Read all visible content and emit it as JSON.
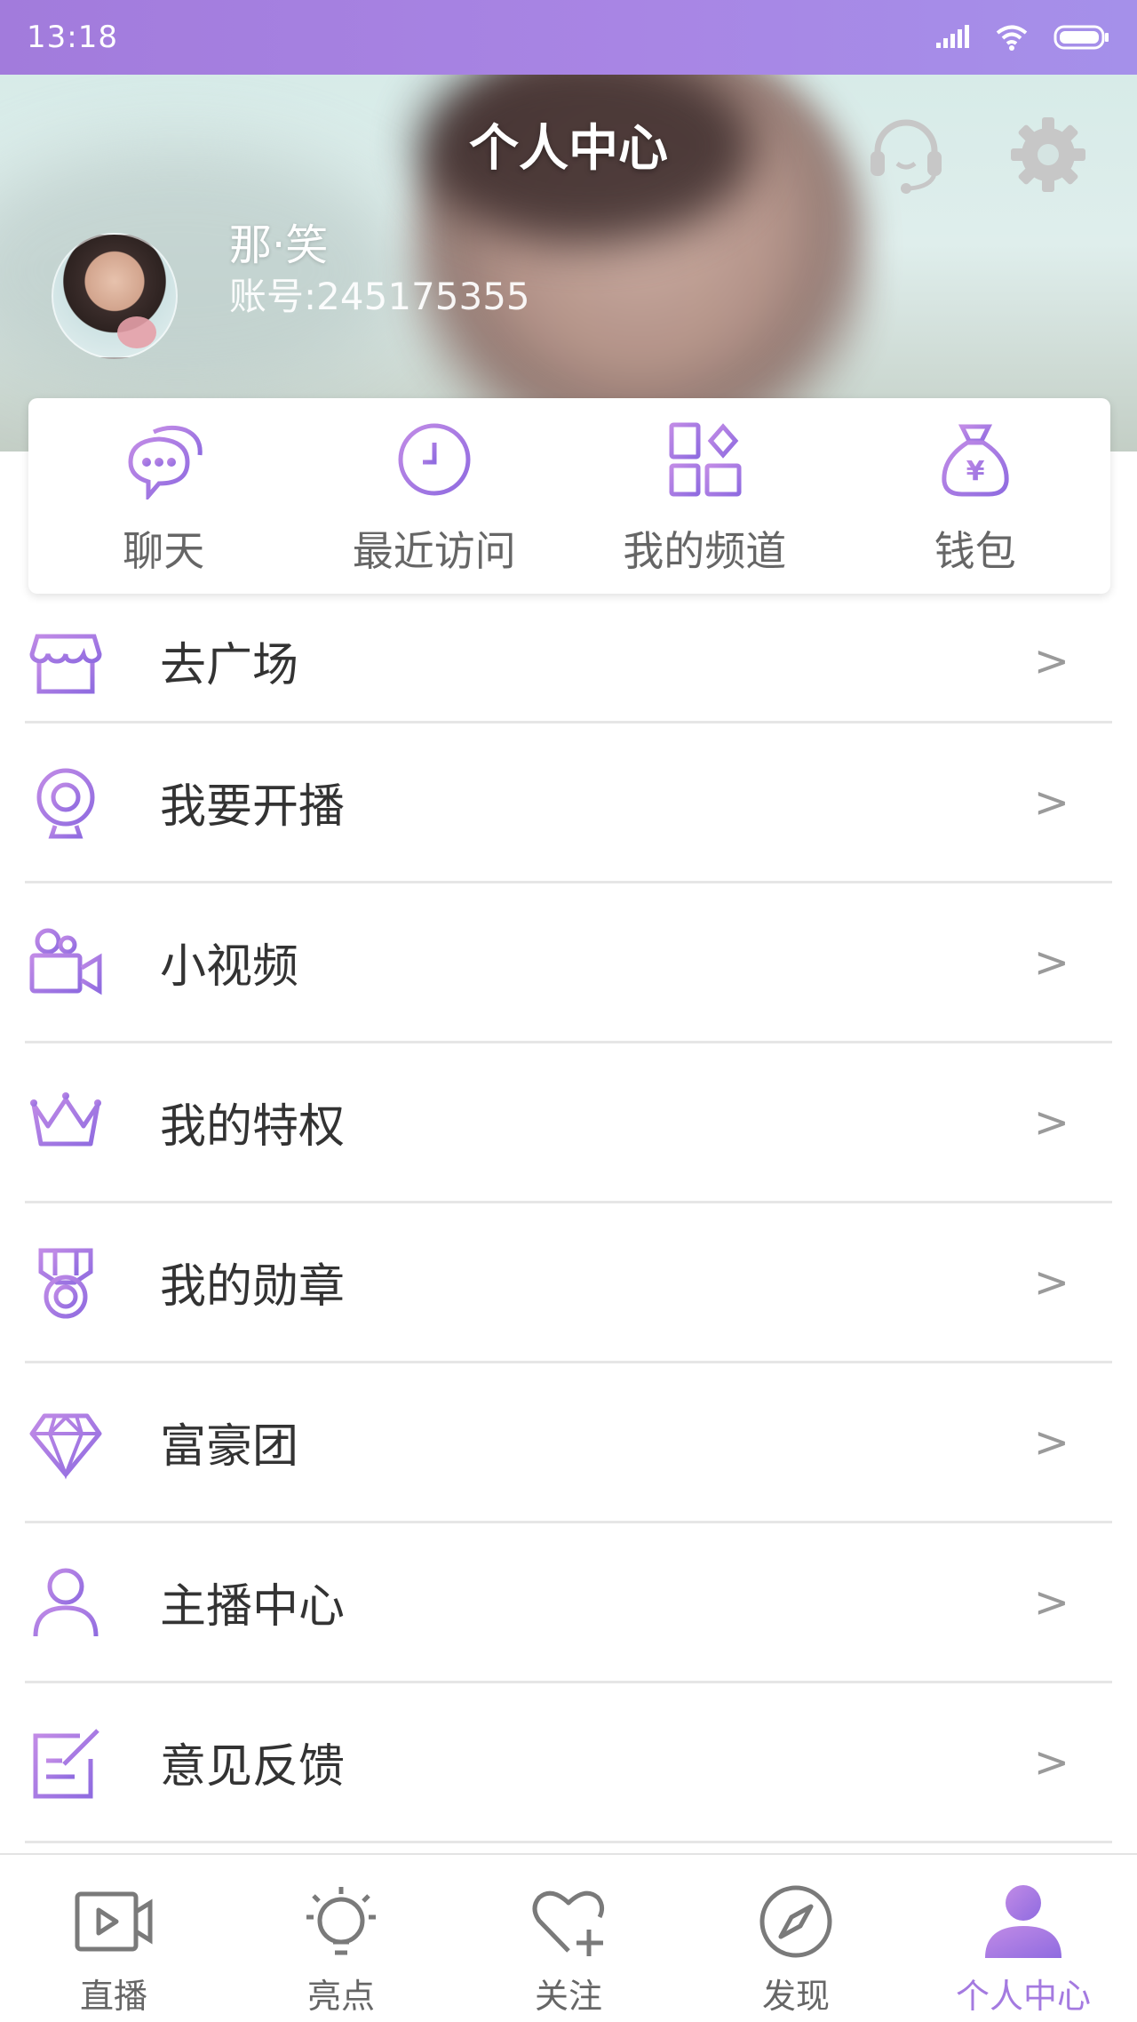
{
  "status_bar": {
    "time": "13:18"
  },
  "header": {
    "title": "个人中心",
    "user": {
      "name": "那·笑",
      "account": "账号:245175355"
    }
  },
  "quick_actions": [
    {
      "label": "聊天",
      "icon": "chat-bubble-icon"
    },
    {
      "label": "最近访问",
      "icon": "clock-icon"
    },
    {
      "label": "我的频道",
      "icon": "channel-grid-icon"
    },
    {
      "label": "钱包",
      "icon": "money-bag-icon"
    }
  ],
  "menu": [
    {
      "label": "去广场",
      "icon": "store-icon",
      "arrow": ">"
    },
    {
      "label": "我要开播",
      "icon": "webcam-icon",
      "arrow": ">"
    },
    {
      "label": "小视频",
      "icon": "video-camera-icon",
      "arrow": ">"
    },
    {
      "label": "我的特权",
      "icon": "crown-icon",
      "arrow": ">"
    },
    {
      "label": "我的勋章",
      "icon": "medal-icon",
      "arrow": ">"
    },
    {
      "label": "富豪团",
      "icon": "diamond-icon",
      "arrow": ">"
    },
    {
      "label": "主播中心",
      "icon": "user-icon",
      "arrow": ">"
    },
    {
      "label": "意见反馈",
      "icon": "feedback-edit-icon",
      "arrow": ">"
    }
  ],
  "bottom_nav": [
    {
      "label": "直播",
      "icon": "play-video-icon",
      "active": false
    },
    {
      "label": "亮点",
      "icon": "lightbulb-icon",
      "active": false
    },
    {
      "label": "关注",
      "icon": "heart-plus-icon",
      "active": false
    },
    {
      "label": "发现",
      "icon": "compass-icon",
      "active": false
    },
    {
      "label": "个人中心",
      "icon": "person-filled-icon",
      "active": true
    }
  ],
  "colors": {
    "accent": "#a47ae0",
    "accent_gradient_start": "#9d6fe0",
    "accent_gradient_end": "#c089e6",
    "inactive_icon": "#7a7a7a",
    "divider": "#e6e6e6"
  }
}
